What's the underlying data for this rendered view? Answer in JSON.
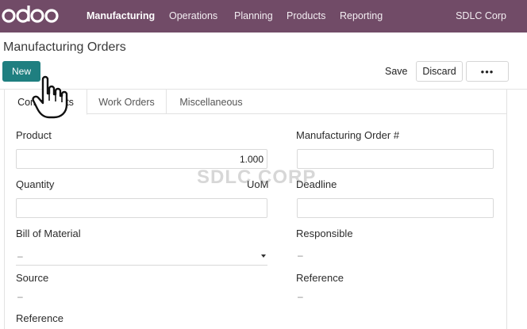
{
  "topbar": {
    "logo_text": "odoo",
    "nav": [
      "Manufacturing",
      "Operations",
      "Planning",
      "Products",
      "Reporting"
    ],
    "company": "SDLC Corp"
  },
  "page": {
    "title": "Manufacturing Orders"
  },
  "toolbar": {
    "new_label": "New",
    "save_label": "Save",
    "discard_label": "Discard",
    "more_label": "•••"
  },
  "tabs": [
    {
      "label": "Components",
      "active": true
    },
    {
      "label": "Work Orders",
      "active": false
    },
    {
      "label": "Miscellaneous",
      "active": false
    }
  ],
  "form": {
    "product_label": "Product",
    "product_value": "1.000",
    "mo_number_label": "Manufacturing Order #",
    "mo_number_value": "",
    "quantity_label": "Quantity",
    "uom_label": "UoM",
    "quantity_value": "",
    "deadline_label": "Deadline",
    "deadline_value": "",
    "bom_label": "Bill of Material",
    "bom_value": "–",
    "responsible_label": "Responsible",
    "responsible_value": "–",
    "source_label": "Source",
    "source_value": "–",
    "reference_right_label": "Reference",
    "reference_right_value": "–",
    "reference_left_label": "Reference"
  },
  "watermark": "SDLC CORP",
  "colors": {
    "topbar": "#714b67",
    "primary_button": "#1f7f80"
  },
  "icons": {
    "cursor": "hand-pointer-icon",
    "dropdown": "caret-down-icon"
  }
}
